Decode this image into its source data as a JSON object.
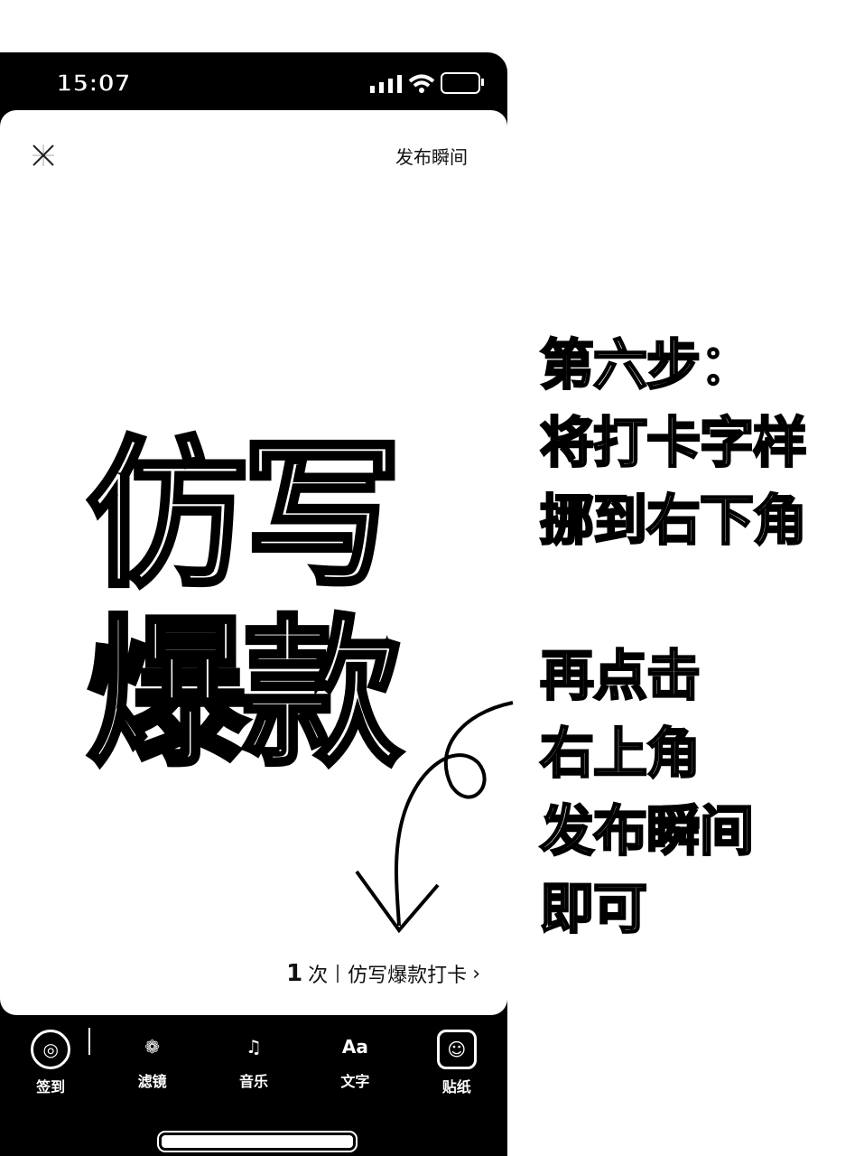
{
  "status": {
    "time": "15:07"
  },
  "header": {
    "publish_label": "发布瞬间",
    "close_icon": "close-icon"
  },
  "cover": {
    "line1": "仿写",
    "line2": "爆款"
  },
  "checkin": {
    "count": "1",
    "unit": "次",
    "label": "仿写爆款打卡"
  },
  "toolbar": {
    "items": [
      {
        "label": "签到",
        "icon": "checkin-icon"
      },
      {
        "label": "滤镜",
        "icon": "filter-icon"
      },
      {
        "label": "音乐",
        "icon": "music-icon"
      },
      {
        "label": "文字",
        "icon": "text-icon"
      },
      {
        "label": "贴纸",
        "icon": "sticker-icon"
      }
    ]
  },
  "instructions": {
    "lines_a": [
      "第六步：",
      "将打卡字样",
      "挪到右下角"
    ],
    "lines_b": [
      "再点击",
      "右上角",
      "发布瞬间",
      "即可"
    ]
  }
}
